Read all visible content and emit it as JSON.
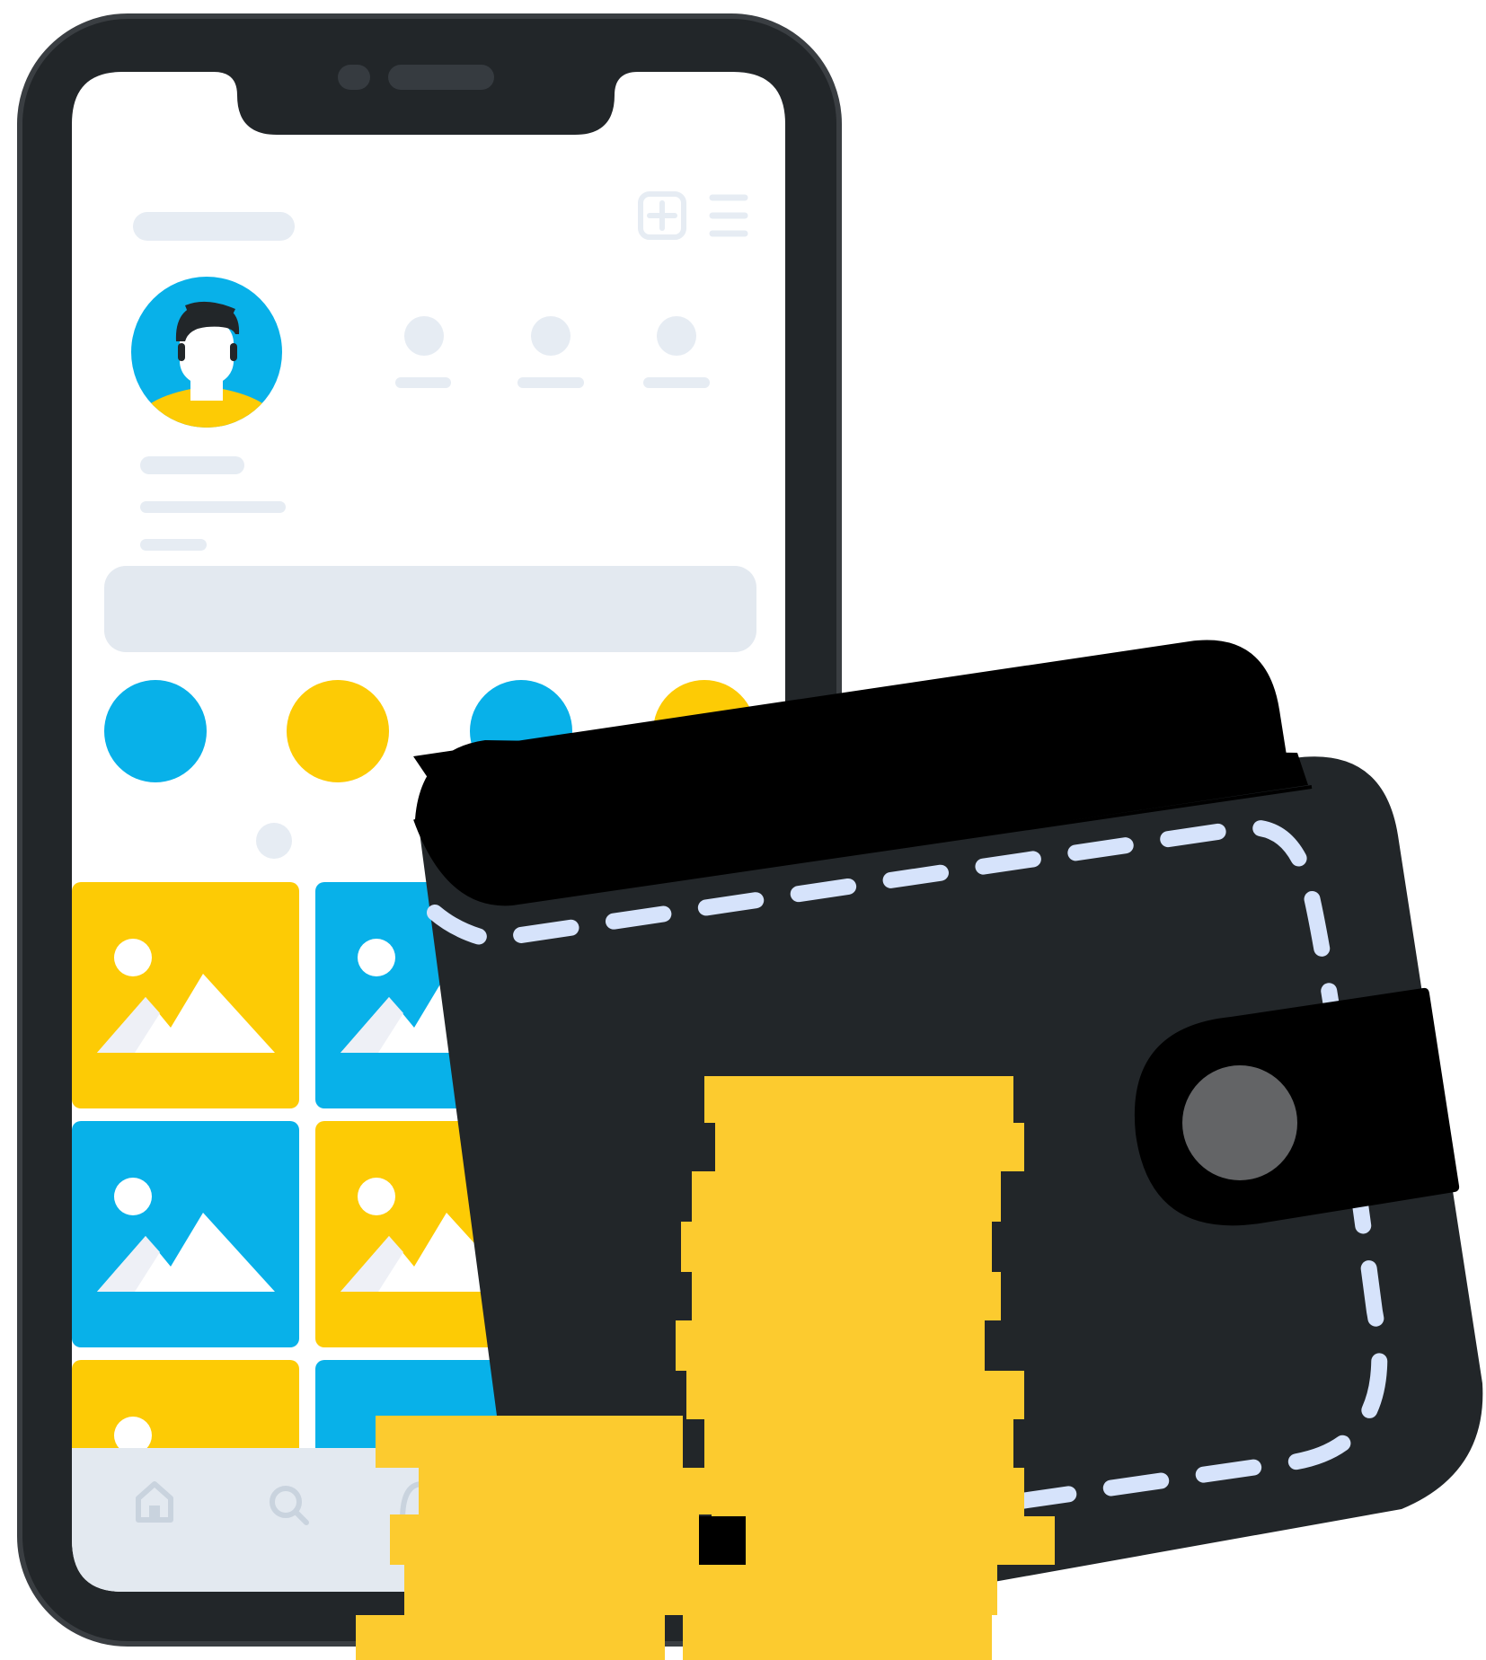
{
  "illustration": {
    "colors": {
      "phone_body": "#222629",
      "phone_body_edge": "#3a3e42",
      "screen": "#ffffff",
      "placeholder": "#e6ecf3",
      "bottom_bar": "#e3e9f0",
      "nav_icon": "#c9d3de",
      "blue": "#08b1e9",
      "yellow": "#fdcb05",
      "photo_mountain": "#ffffff",
      "photo_mountain_shade": "#eef0f6",
      "avatar_skin": "#ffffff",
      "avatar_hair": "#222629",
      "wallet_back": "#000000",
      "wallet_front": "#222629",
      "wallet_stitch": "#d6e3fb",
      "wallet_clasp": "#000000",
      "wallet_button": "#636466",
      "coin": "#fccb2f"
    },
    "phone": {
      "header_icons": [
        "add-square-icon",
        "menu-icon"
      ],
      "stat_count": 3,
      "story_colors": [
        "blue",
        "yellow",
        "blue",
        "yellow"
      ],
      "photo_tiles": [
        "yellow",
        "blue",
        "blue",
        "yellow",
        "yellow",
        "blue"
      ],
      "nav_icons": [
        "home-icon",
        "search-icon",
        "chat-icon"
      ]
    },
    "wallet": {
      "parts": [
        "wallet-back-flap",
        "wallet-front",
        "wallet-stitching",
        "wallet-clasp",
        "clasp-button"
      ]
    },
    "coins": {
      "stacks": [
        "tall-coin-stack",
        "short-coin-stack"
      ]
    }
  }
}
